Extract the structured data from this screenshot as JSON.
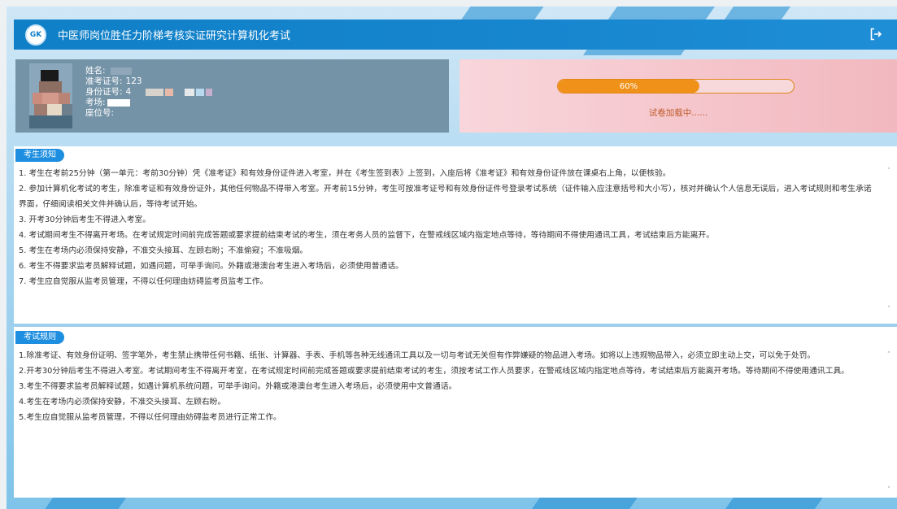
{
  "header": {
    "title": "中医师岗位胜任力阶梯考核实证研究计算机化考试",
    "logo_text": "GK"
  },
  "candidate": {
    "name_label": "姓名:",
    "name_value": "",
    "admission_label": "准考证号:",
    "admission_value": "123",
    "id_label": "身份证号:",
    "id_value": "4",
    "room_label": "考场:",
    "room_value": "",
    "seat_label": "座位号:",
    "seat_value": ""
  },
  "progress": {
    "percent": 60,
    "percent_text": "60%",
    "status_text": "试卷加载中......"
  },
  "notice": {
    "title": "考生须知",
    "items": [
      "1. 考生在考前25分钟（第一单元：考前30分钟）凭《准考证》和有效身份证件进入考室，并在《考生签到表》上签到，入座后将《准考证》和有效身份证件放在课桌右上角，以便核验。",
      "2. 参加计算机化考试的考生，除准考证和有效身份证外，其他任何物品不得带入考室。开考前15分钟，考生可按准考证号和有效身份证件号登录考试系统（证件输入应注意括号和大小写），核对并确认个人信息无误后，进入考试规则和考生承诺界面，仔细阅读相关文件并确认后，等待考试开始。",
      "3. 开考30分钟后考生不得进入考室。",
      "4. 考试期间考生不得离开考场。在考试规定时间前完成答题或要求提前结束考试的考生，须在考务人员的监督下，在警戒线区域内指定地点等待，等待期间不得使用通讯工具，考试结束后方能离开。",
      "5. 考生在考场内必须保持安静，不准交头接耳、左顾右盼；不准偷窥；不准吸烟。",
      "6. 考生不得要求监考员解释试题，如遇问题，可举手询问。外籍或港澳台考生进入考场后，必须使用普通话。",
      "7. 考生应自觉服从监考员管理，不得以任何理由妨碍监考员监考工作。"
    ]
  },
  "rules": {
    "title": "考试规则",
    "items": [
      "1.除准考证、有效身份证明、签字笔外，考生禁止携带任何书籍、纸张、计算器、手表、手机等各种无线通讯工具以及一切与考试无关但有作弊嫌疑的物品进入考场。如将以上违规物品带入，必须立即主动上交，可以免于处罚。",
      "2.开考30分钟后考生不得进入考室。考试期间考生不得离开考室，在考试规定时间前完成答题或要求提前结束考试的考生，须按考试工作人员要求，在警戒线区域内指定地点等待，考试结束后方能离开考场。等待期间不得使用通讯工具。",
      "3.考生不得要求监考员解释试题，如遇计算机系统问题，可举手询问。外籍或港澳台考生进入考场后，必须使用中文普通话。",
      "4.考生在考场内必须保持安静，不准交头接耳、左顾右盼。",
      "5.考生应自觉服从监考员管理，不得以任何理由妨碍监考员进行正常工作。"
    ]
  },
  "colors": {
    "header_bg": "#0f7fc7",
    "candidate_bg": "#7593a7",
    "progress_fill": "#f0911a",
    "progress_track": "#f7d9dc",
    "tag_bg": "#1d8ee0"
  },
  "icons": {
    "logout": "logout-icon",
    "scroll_up": "chevron-up-icon",
    "scroll_down": "chevron-down-icon"
  }
}
